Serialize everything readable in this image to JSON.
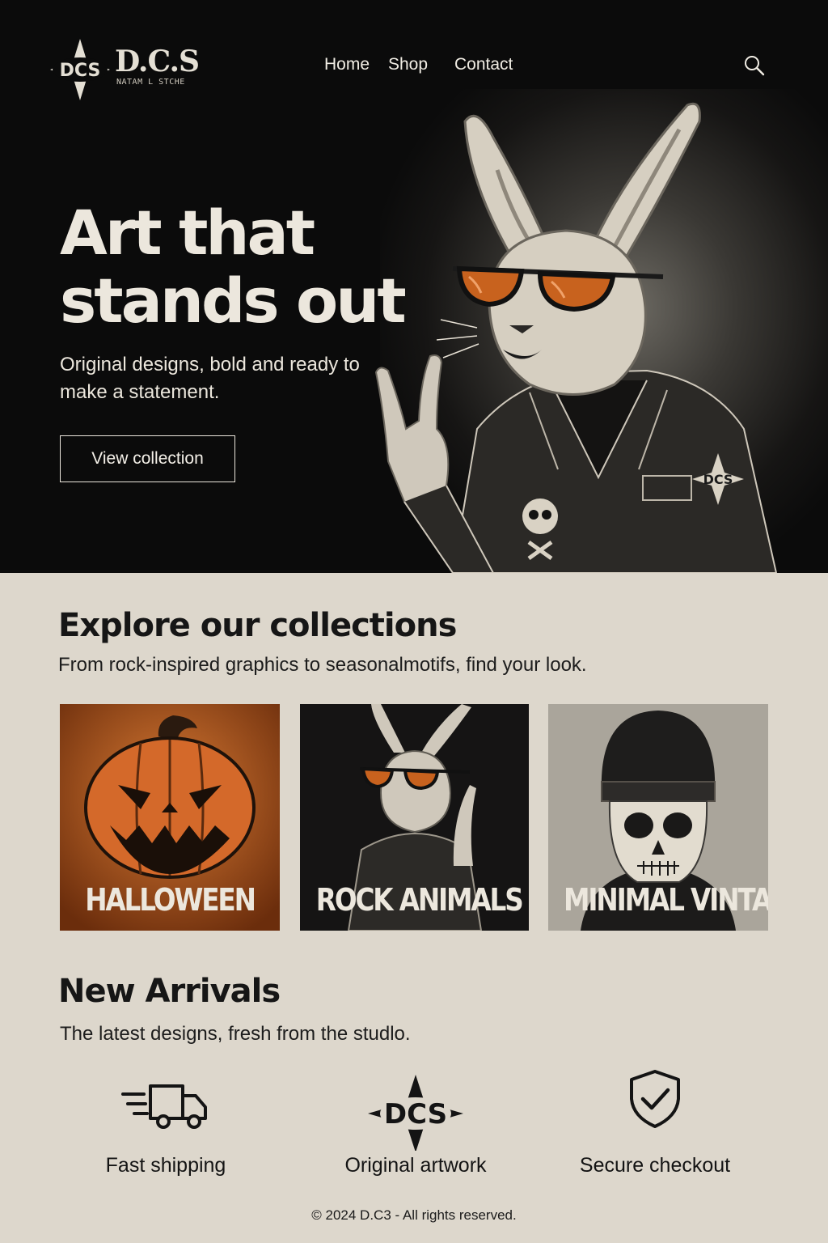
{
  "brand": {
    "logo_mark_text": "DCS",
    "logo_text": "D.C.S",
    "logo_subtext": "NATAM L STCHE"
  },
  "nav": {
    "items": [
      {
        "label": "Home"
      },
      {
        "label": "Shop"
      },
      {
        "label": "Contact"
      }
    ],
    "search_icon": "search-icon"
  },
  "hero": {
    "title": "Art that stands out",
    "subtitle": "Original designs, bold and ready to make a statement.",
    "cta_label": "View collection",
    "jacket_patch_text": "DCS"
  },
  "collections": {
    "title": "Explore our collections",
    "subtitle": "From rock-inspired graphics to seasonalmotifs, find your look.",
    "cards": [
      {
        "label": "HALLOWEEN",
        "background": "#c8621e"
      },
      {
        "label": "ROCK ANIMALS",
        "background": "#141414"
      },
      {
        "label": "MINIMAL VINTAGE",
        "background": "#aaa59b"
      }
    ]
  },
  "new_arrivals": {
    "title": "New Arrivals",
    "subtitle": "The latest designs, fresh from the studlo."
  },
  "features": [
    {
      "label": "Fast shipping",
      "icon": "truck-icon"
    },
    {
      "label": "Original artwork",
      "icon": "dcs-star-logo-icon",
      "mark_text": "DCS"
    },
    {
      "label": "Secure checkout",
      "icon": "shield-check-icon"
    }
  ],
  "footer": {
    "copyright": "© 2024 D.C3 - All rights reserved."
  },
  "colors": {
    "hero_bg": "#0b0b0b",
    "page_bg": "#ddd7cc",
    "accent_orange": "#c8621e",
    "text_light": "#ece7dd",
    "text_dark": "#141414"
  }
}
